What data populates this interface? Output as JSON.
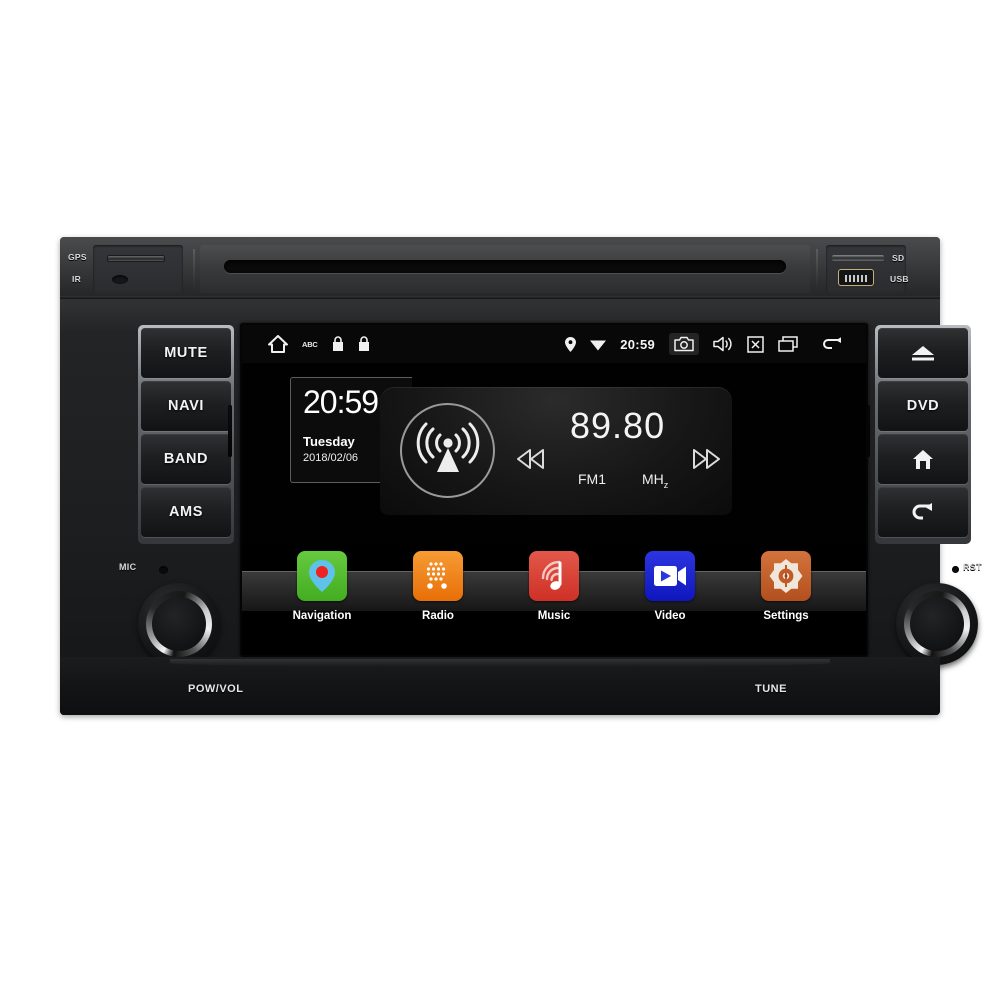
{
  "device": {
    "name": "car-head-unit",
    "top_bezel": {
      "gps_label": "GPS",
      "ir_label": "IR",
      "sd_label": "SD",
      "usb_label": "USB"
    },
    "bottom_bezel": {
      "pow_vol_label": "POW/VOL",
      "tune_label": "TUNE",
      "mic_label": "MIC",
      "rst_label": "RST"
    },
    "left_buttons": [
      {
        "label": "MUTE",
        "icon": ""
      },
      {
        "label": "NAVI",
        "icon": ""
      },
      {
        "label": "BAND",
        "icon": ""
      },
      {
        "label": "AMS",
        "icon": ""
      }
    ],
    "right_buttons": [
      {
        "label": "",
        "icon": "eject-icon"
      },
      {
        "label": "DVD",
        "icon": ""
      },
      {
        "label": "",
        "icon": "home-icon"
      },
      {
        "label": "",
        "icon": "back-arrow-icon"
      }
    ]
  },
  "screen": {
    "statusbar": {
      "left_icons": [
        {
          "name": "home-icon",
          "glyph": "home"
        },
        {
          "name": "abc-keyboard-icon",
          "text": "ABC"
        },
        {
          "name": "lock-icon-1",
          "glyph": "lock"
        },
        {
          "name": "lock-icon-2",
          "glyph": "lock"
        }
      ],
      "right_icons": [
        {
          "name": "location-pin-icon",
          "glyph": "pin"
        },
        {
          "name": "wifi-icon",
          "glyph": "wifi"
        }
      ],
      "time": "20:59",
      "nav_icons": [
        {
          "name": "screenshot-camera-icon",
          "glyph": "camera",
          "highlighted": true
        },
        {
          "name": "volume-icon",
          "glyph": "speaker",
          "highlighted": false
        },
        {
          "name": "close-icon",
          "glyph": "x-box",
          "highlighted": false
        },
        {
          "name": "recents-icon",
          "glyph": "recents",
          "highlighted": false
        },
        {
          "name": "back-icon",
          "glyph": "back",
          "highlighted": false
        }
      ]
    },
    "clock_widget": {
      "time": "20:59",
      "weekday": "Tuesday",
      "date": "2018/02/06"
    },
    "radio_widget": {
      "frequency": "89.80",
      "band": "FM1",
      "unit_main": "MH",
      "unit_sub": "z",
      "prev_label": "seek-down",
      "next_label": "seek-up",
      "antenna_icon": "broadcast-antenna-icon"
    },
    "dock": [
      {
        "label": "Navigation",
        "icon": "navigation-pin-icon",
        "color": "#4caf2a",
        "color2": "#67c93f"
      },
      {
        "label": "Radio",
        "icon": "radio-grill-icon",
        "color": "#ef7d13",
        "color2": "#f79b34"
      },
      {
        "label": "Music",
        "icon": "music-note-icon",
        "color": "#d8392f",
        "color2": "#e2584a"
      },
      {
        "label": "Video",
        "icon": "video-camera-icon",
        "color": "#1c23cf",
        "color2": "#3340e8"
      },
      {
        "label": "Settings",
        "icon": "settings-gear-icon",
        "color": "#c05a28",
        "color2": "#d4733c"
      }
    ]
  },
  "colors": {
    "screen_bg": "#010101",
    "statusbar_bg": "#080808",
    "accent_white": "#f4f4f4",
    "bezel_dark": "#1d1e20",
    "bezel_light": "#4a4b4d"
  }
}
